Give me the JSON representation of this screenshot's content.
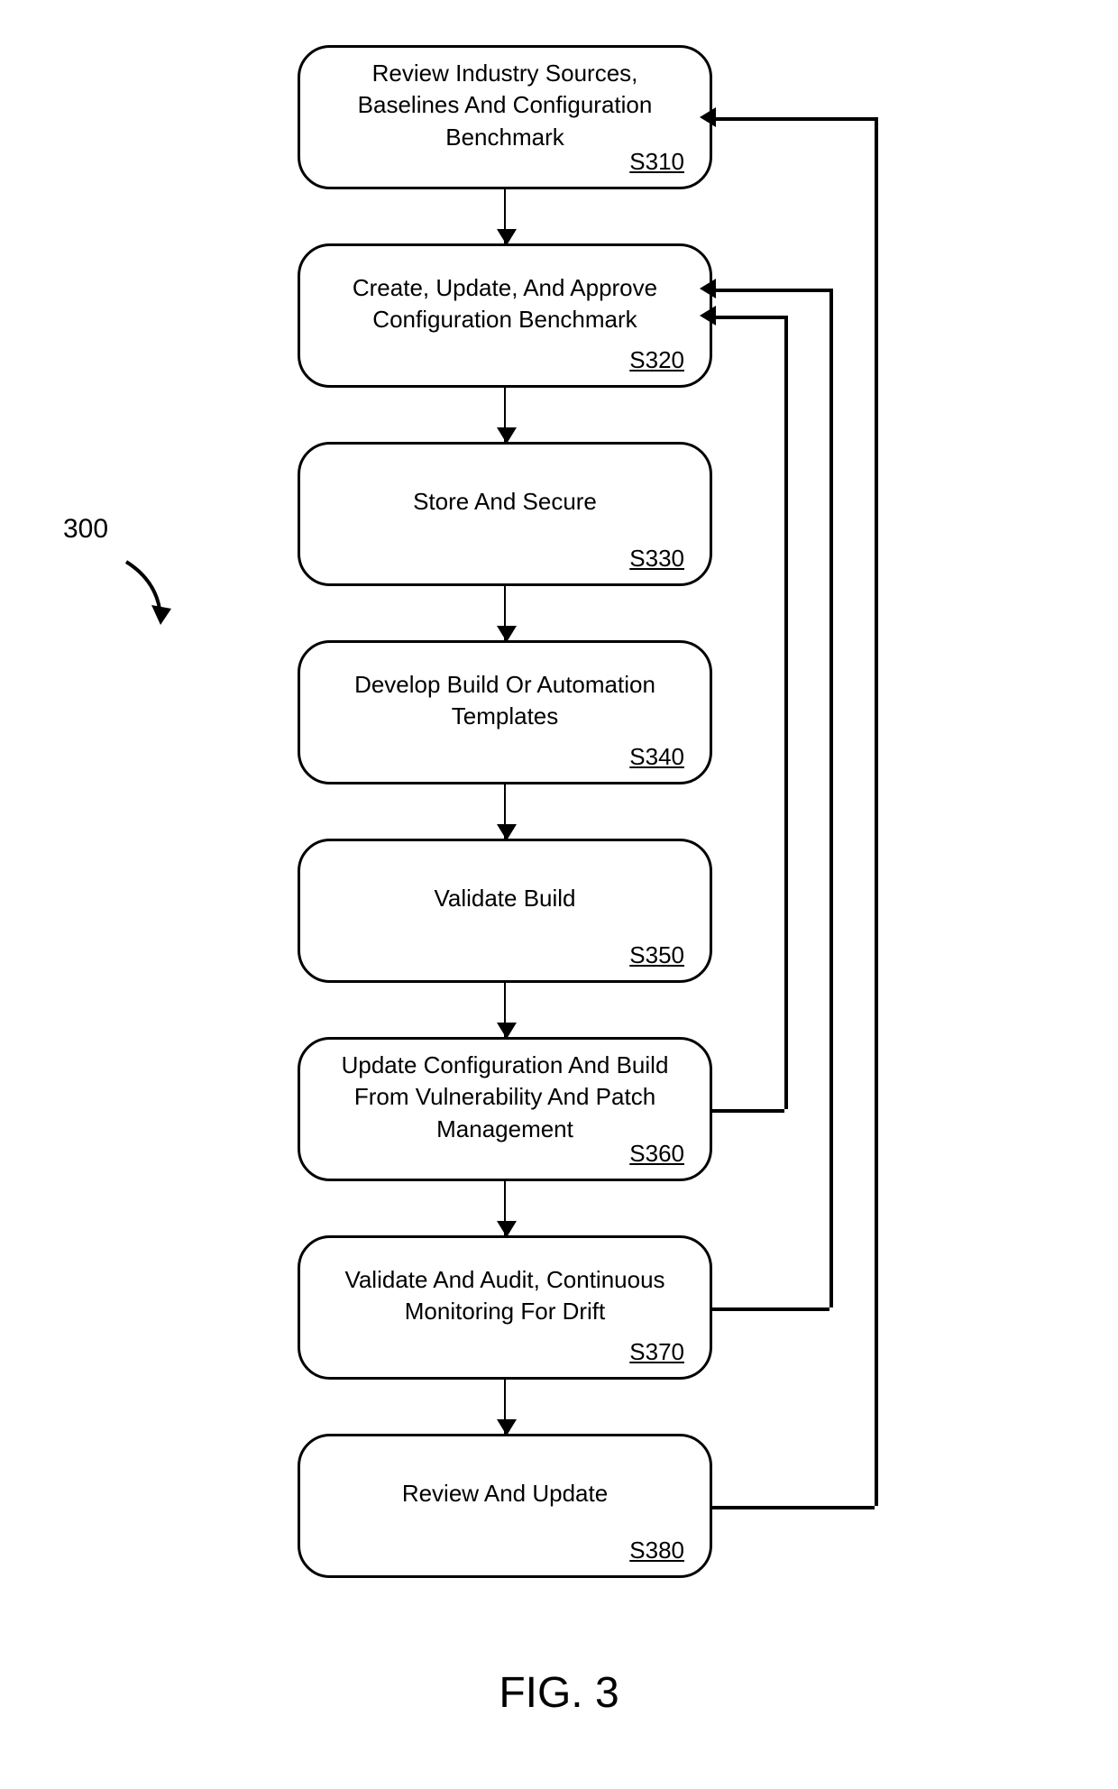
{
  "chart_data": {
    "type": "flowchart",
    "title": "FIG. 3",
    "reference_number": "300",
    "steps": [
      {
        "id": "S310",
        "label": "Review Industry Sources, Baselines And Configuration Benchmark"
      },
      {
        "id": "S320",
        "label": "Create, Update, And Approve Configuration Benchmark"
      },
      {
        "id": "S330",
        "label": "Store And Secure"
      },
      {
        "id": "S340",
        "label": "Develop Build Or Automation Templates"
      },
      {
        "id": "S350",
        "label": "Validate Build"
      },
      {
        "id": "S360",
        "label": "Update Configuration And Build From Vulnerability And Patch Management"
      },
      {
        "id": "S370",
        "label": "Validate And Audit, Continuous Monitoring For Drift"
      },
      {
        "id": "S380",
        "label": "Review And Update"
      }
    ],
    "feedback_edges": [
      {
        "from": "S360",
        "to": "S320"
      },
      {
        "from": "S370",
        "to": "S320"
      },
      {
        "from": "S380",
        "to": "S310"
      }
    ]
  }
}
